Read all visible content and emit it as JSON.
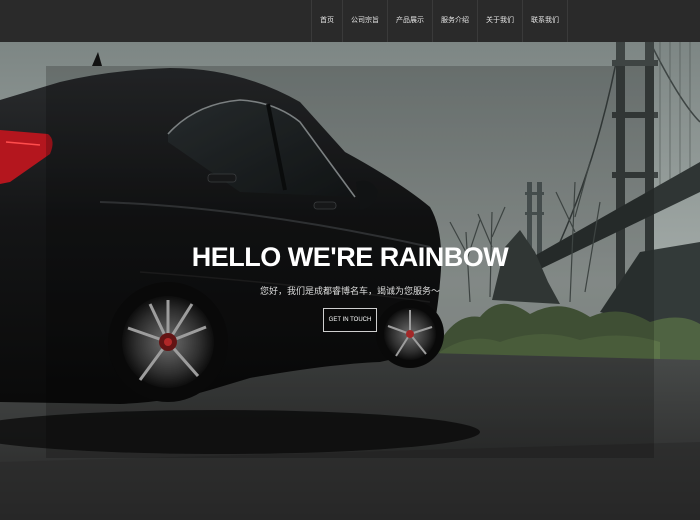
{
  "nav": {
    "items": [
      {
        "label": "首页"
      },
      {
        "label": "公司宗旨"
      },
      {
        "label": "产品展示"
      },
      {
        "label": "服务介绍"
      },
      {
        "label": "关于我们"
      },
      {
        "label": "联系我们"
      }
    ]
  },
  "hero": {
    "title": "HELLO WE'RE RAINBOW",
    "subtitle": "您好，我们是成都睿博名车，竭诚为您服务～",
    "cta_label": "GET IN TOUCH"
  }
}
